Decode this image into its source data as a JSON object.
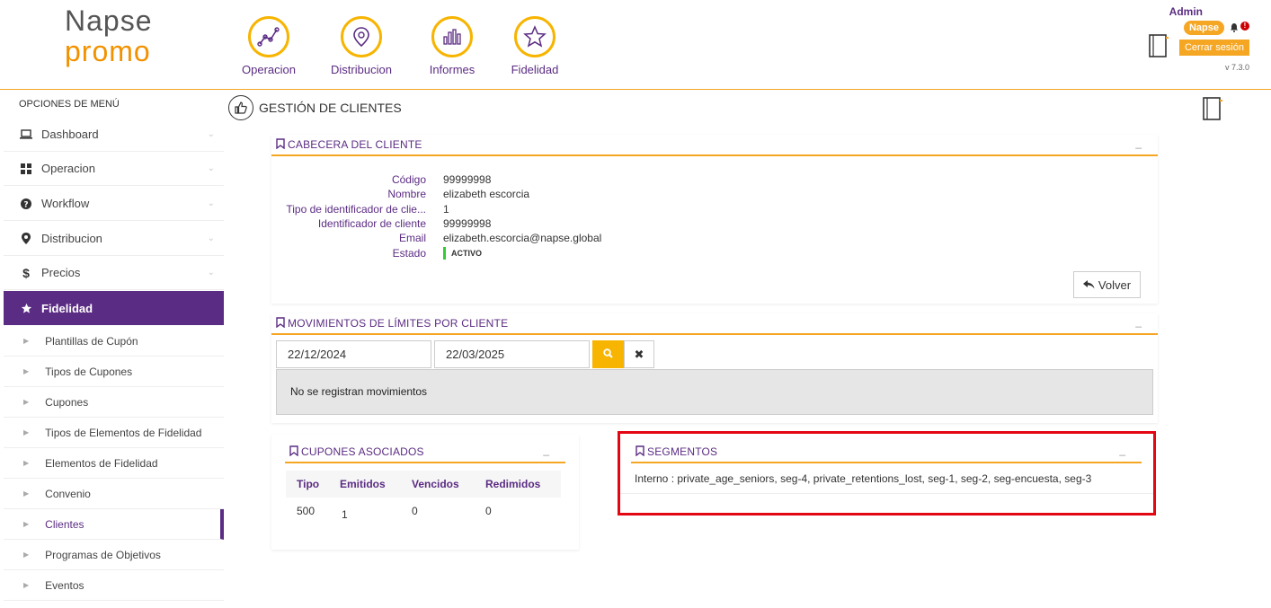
{
  "logo": {
    "line1": "Napse",
    "line2": "promo"
  },
  "topnav": [
    {
      "label": "Operacion",
      "icon": "chart-line-icon"
    },
    {
      "label": "Distribucion",
      "icon": "map-pin-icon"
    },
    {
      "label": "Informes",
      "icon": "bar-chart-icon"
    },
    {
      "label": "Fidelidad",
      "icon": "star-icon"
    }
  ],
  "user": {
    "name": "Admin",
    "badge": "Napse",
    "logout": "Cerrar sesión",
    "version": "v 7.3.0",
    "alert": "!"
  },
  "sidebar": {
    "title": "OPCIONES DE MENÚ",
    "items": [
      {
        "label": "Dashboard",
        "icon": "laptop-icon"
      },
      {
        "label": "Operacion",
        "icon": "grid-icon"
      },
      {
        "label": "Workflow",
        "icon": "question-icon"
      },
      {
        "label": "Distribucion",
        "icon": "map-pin-icon"
      },
      {
        "label": "Precios",
        "icon": "dollar-icon"
      },
      {
        "label": "Fidelidad",
        "icon": "star-icon"
      }
    ],
    "subitems": [
      "Plantillas de Cupón",
      "Tipos de Cupones",
      "Cupones",
      "Tipos de Elementos de Fidelidad",
      "Elementos de Fidelidad",
      "Convenio",
      "Clientes",
      "Programas de Objetivos",
      "Eventos"
    ]
  },
  "page": {
    "title": "GESTIÓN DE CLIENTES"
  },
  "header_panel": {
    "title": "CABECERA DEL CLIENTE",
    "min": "_",
    "fields": [
      {
        "label": "Código",
        "value": "99999998"
      },
      {
        "label": "Nombre",
        "value": "elizabeth escorcia"
      },
      {
        "label": "Tipo de identificador de clie...",
        "value": "1"
      },
      {
        "label": "Identificador de cliente",
        "value": "99999998"
      },
      {
        "label": "Email",
        "value": "elizabeth.escorcia@napse.global"
      },
      {
        "label": "Estado",
        "value": "ACTIVO"
      }
    ],
    "back_button": "Volver"
  },
  "movements_panel": {
    "title": "MOVIMIENTOS DE LÍMITES POR CLIENTE",
    "min": "_",
    "date_from": "22/12/2024",
    "date_to": "22/03/2025",
    "empty_message": "No se registran movimientos"
  },
  "coupons_panel": {
    "title": "CUPONES ASOCIADOS",
    "min": "_",
    "columns": [
      "Tipo",
      "Emitidos",
      "Vencidos",
      "Redimidos"
    ],
    "rows": [
      [
        "500",
        "1",
        "0",
        "0"
      ]
    ]
  },
  "segments_panel": {
    "title": "SEGMENTOS",
    "min": "_",
    "text": "Interno : private_age_seniors, seg-4, private_retentions_lost, seg-1, seg-2, seg-encuesta, seg-3"
  },
  "colors": {
    "accent": "#f5a623",
    "brand": "#5b2c83",
    "highlight": "#e30613",
    "status_active": "#33cc33"
  }
}
